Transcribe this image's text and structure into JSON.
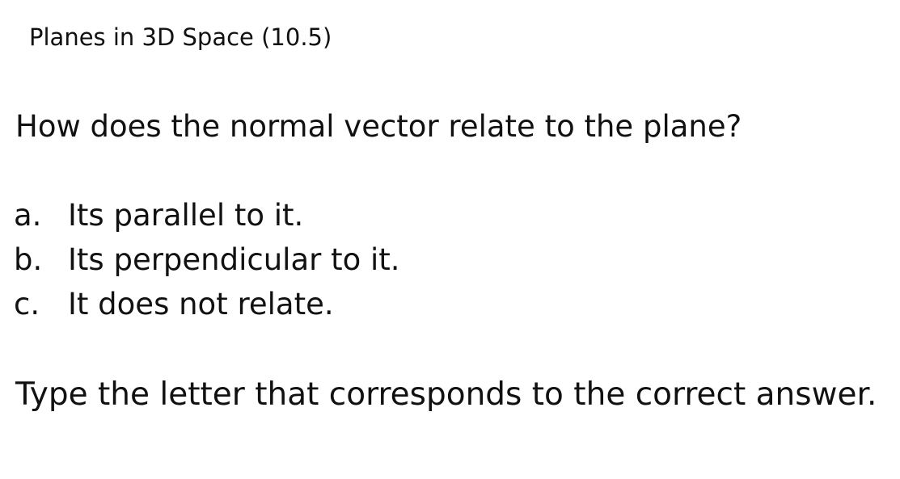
{
  "header": {
    "section_title": "Planes in 3D Space (10.5)"
  },
  "quiz": {
    "question": "How does the normal vector relate to the plane?",
    "options": [
      {
        "letter": "a.",
        "text": "Its parallel to it."
      },
      {
        "letter": "b.",
        "text": "Its perpendicular to it."
      },
      {
        "letter": "c.",
        "text": "It does not relate."
      }
    ],
    "instruction": "Type the letter that corresponds to the correct answer."
  }
}
